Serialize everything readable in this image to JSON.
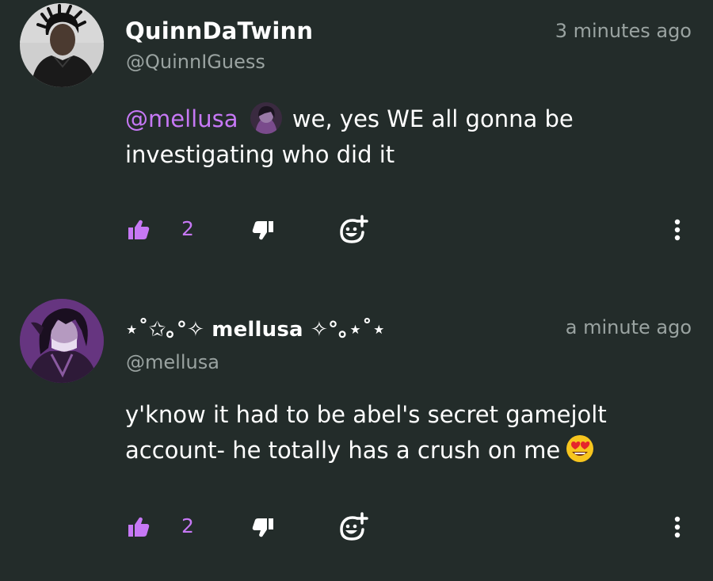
{
  "comments": [
    {
      "display_name": "QuinnDaTwinn",
      "handle": "@QuinnIGuess",
      "timestamp": "3 minutes ago",
      "mention": "@mellusa",
      "text_line1": "we, yes WE all gonna be",
      "text_line2": "investigating who did it",
      "like_count": "2",
      "avatar": "avatar-photo-man"
    },
    {
      "display_name": "⋆˚✩｡°✧ mellusa ✧°｡⋆˚⋆",
      "handle": "@mellusa",
      "timestamp": "a minute ago",
      "text_line1": "y'know it had to be abel's secret gamejolt",
      "text_line2": "account- he totally has a crush on me",
      "emoji": "heart-eyes-emoji",
      "like_count": "2",
      "avatar": "avatar-anime-purple"
    }
  ],
  "icons": {
    "like": "thumbs-up-icon",
    "dislike": "thumbs-down-icon",
    "react": "add-reaction-icon",
    "more": "more-vertical-icon"
  },
  "colors": {
    "background": "#232c2a",
    "accent": "#c678f5",
    "muted": "#9aa3a1",
    "text": "#ffffff"
  }
}
